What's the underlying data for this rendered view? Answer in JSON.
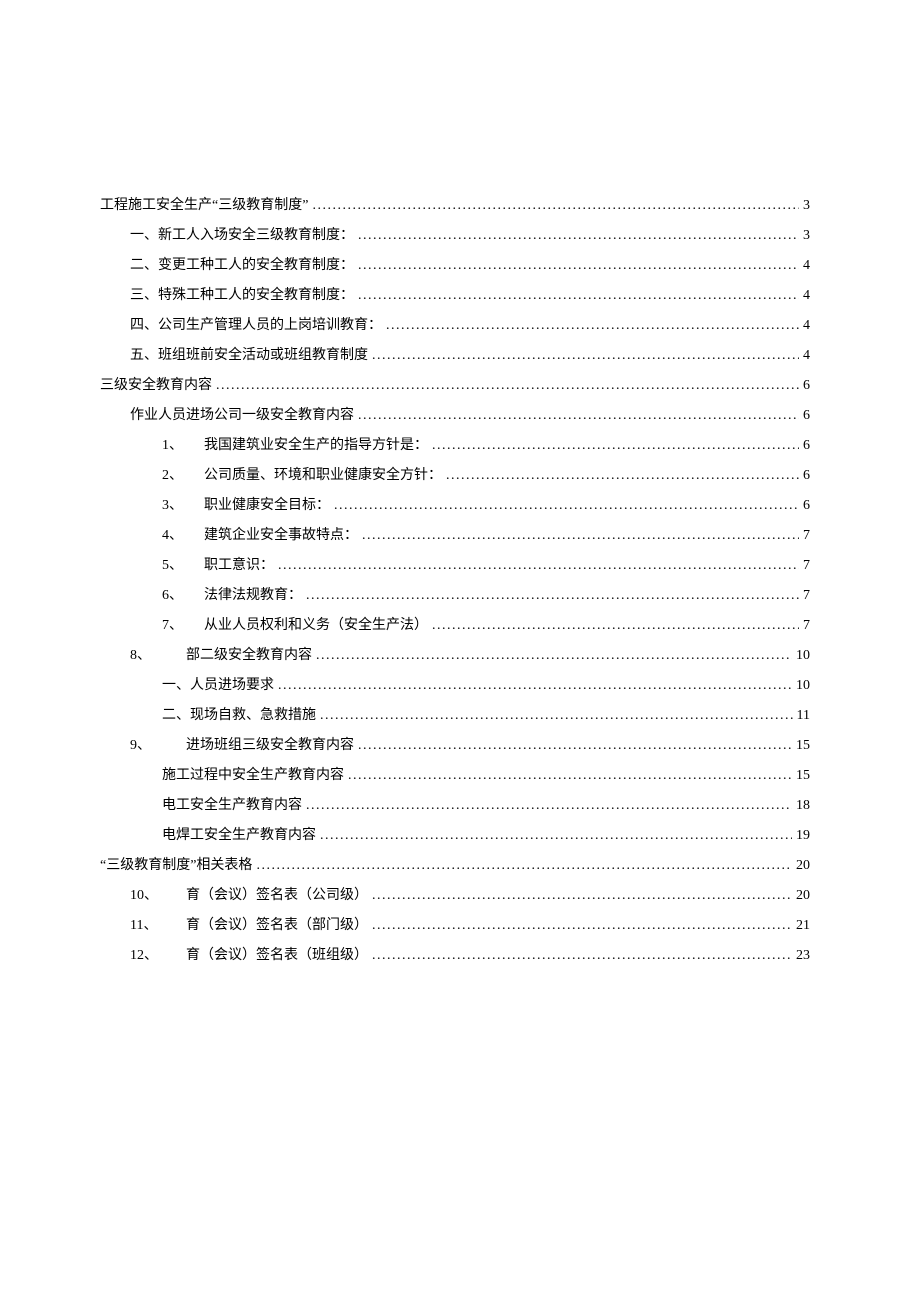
{
  "toc": [
    {
      "indent": "indent-0",
      "label": "工程施工安全生产“三级教育制度”",
      "page": "3"
    },
    {
      "indent": "indent-1",
      "label": "一、新工人入场安全三级教育制度：",
      "page": "3"
    },
    {
      "indent": "indent-1",
      "label": "二、变更工种工人的安全教育制度：",
      "page": "4"
    },
    {
      "indent": "indent-1",
      "label": "三、特殊工种工人的安全教育制度：",
      "page": "4"
    },
    {
      "indent": "indent-1",
      "label": "四、公司生产管理人员的上岗培训教育：",
      "page": "4"
    },
    {
      "indent": "indent-1",
      "label": "五、班组班前安全活动或班组教育制度",
      "page": "4"
    },
    {
      "indent": "indent-0",
      "label": "三级安全教育内容",
      "page": "6"
    },
    {
      "indent": "indent-1",
      "label": "作业人员进场公司一级安全教育内容",
      "page": "6"
    },
    {
      "indent": "indent-2",
      "num": "1、",
      "label": "我国建筑业安全生产的指导方针是：",
      "page": "6"
    },
    {
      "indent": "indent-2",
      "num": "2、",
      "label": "公司质量、环境和职业健康安全方针：",
      "page": "6"
    },
    {
      "indent": "indent-2",
      "num": "3、",
      "label": "职业健康安全目标：",
      "page": "6"
    },
    {
      "indent": "indent-2",
      "num": "4、",
      "label": "建筑企业安全事故特点：",
      "page": "7"
    },
    {
      "indent": "indent-2",
      "num": "5、",
      "label": "职工意识：",
      "page": "7"
    },
    {
      "indent": "indent-2",
      "num": "6、",
      "label": "法律法规教育：",
      "page": "7"
    },
    {
      "indent": "indent-2",
      "num": "7、",
      "label": "从业人员权利和义务（安全生产法）",
      "page": "7"
    },
    {
      "indent": "indent-2alt",
      "num": "8、",
      "label": "部二级安全教育内容",
      "page": "10"
    },
    {
      "indent": "indent-3",
      "label": "一、人员进场要求",
      "page": "10"
    },
    {
      "indent": "indent-3",
      "label": "二、现场自救、急救措施",
      "page": "11"
    },
    {
      "indent": "indent-2alt",
      "num": "9、",
      "label": "进场班组三级安全教育内容",
      "page": "15"
    },
    {
      "indent": "indent-3",
      "label": "施工过程中安全生产教育内容",
      "page": "15"
    },
    {
      "indent": "indent-3",
      "label": "电工安全生产教育内容",
      "page": "18"
    },
    {
      "indent": "indent-3",
      "label": "电焊工安全生产教育内容",
      "page": "19"
    },
    {
      "indent": "indent-0",
      "label": "“三级教育制度”相关表格",
      "page": "20"
    },
    {
      "indent": "indent-2alt",
      "num": "10、",
      "label": "育（会议）签名表（公司级）",
      "page": "20"
    },
    {
      "indent": "indent-2alt",
      "num": "11、",
      "label": "育（会议）签名表（部门级）",
      "page": "21"
    },
    {
      "indent": "indent-2alt",
      "num": "12、",
      "label": "育（会议）签名表（班组级）",
      "page": "23"
    }
  ]
}
